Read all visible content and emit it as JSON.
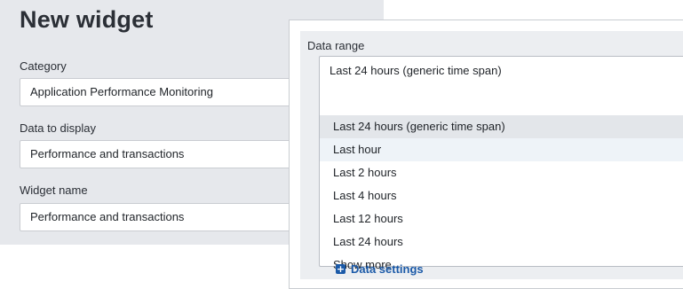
{
  "form": {
    "title": "New widget",
    "category": {
      "label": "Category",
      "value": "Application Performance Monitoring"
    },
    "data_to_display": {
      "label": "Data to display",
      "value": "Performance and transactions"
    },
    "widget_name": {
      "label": "Widget name",
      "value": "Performance and transactions"
    }
  },
  "data_range": {
    "label": "Data range",
    "selected_value": "Last 24 hours (generic time span)",
    "options": [
      "Last 24 hours (generic time span)",
      "Last hour",
      "Last 2 hours",
      "Last 4 hours",
      "Last 12 hours",
      "Last 24 hours",
      "Show more"
    ],
    "selected_index": 0,
    "hovered_index": 1
  },
  "data_settings": {
    "label": "Data settings",
    "icon": "plus-icon"
  },
  "colors": {
    "panel_bg": "#e6e8ec",
    "link_blue": "#1b5aa8",
    "selected_option_bg": "#e3e6ea",
    "hover_option_bg": "#eef3f8"
  }
}
